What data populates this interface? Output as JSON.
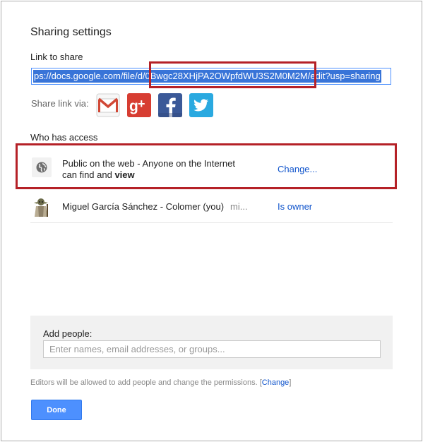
{
  "dialog": {
    "title": "Sharing settings",
    "link_label": "Link to share",
    "link_value": "ps://docs.google.com/file/d/0Bwgc28XHjPA2OWpfdWU3S2M0M2M/edit?usp=sharing",
    "share_via_label": "Share link via:",
    "social": [
      {
        "name": "gmail",
        "icon": "gmail-icon"
      },
      {
        "name": "google-plus",
        "icon": "google-plus-icon"
      },
      {
        "name": "facebook",
        "icon": "facebook-icon"
      },
      {
        "name": "twitter",
        "icon": "twitter-icon"
      }
    ],
    "access_label": "Who has access",
    "access": [
      {
        "icon": "globe-icon",
        "line1": "Public on the web - Anyone on the Internet",
        "line2_prefix": "can find and ",
        "line2_bold": "view",
        "action": "Change..."
      },
      {
        "icon": "avatar",
        "name": "Miguel García Sánchez - Colomer (you)",
        "email": "mi...",
        "role": "Is owner"
      }
    ],
    "add_people_label": "Add people:",
    "add_people_placeholder": "Enter names, email addresses, or groups...",
    "note_text": "Editors will be allowed to add people and change the permissions. [",
    "note_link": "Change",
    "note_end": "]",
    "done_label": "Done"
  },
  "colors": {
    "accent_blue": "#4d90fe",
    "link_blue": "#1155cc",
    "annotation_red": "#b52127"
  }
}
